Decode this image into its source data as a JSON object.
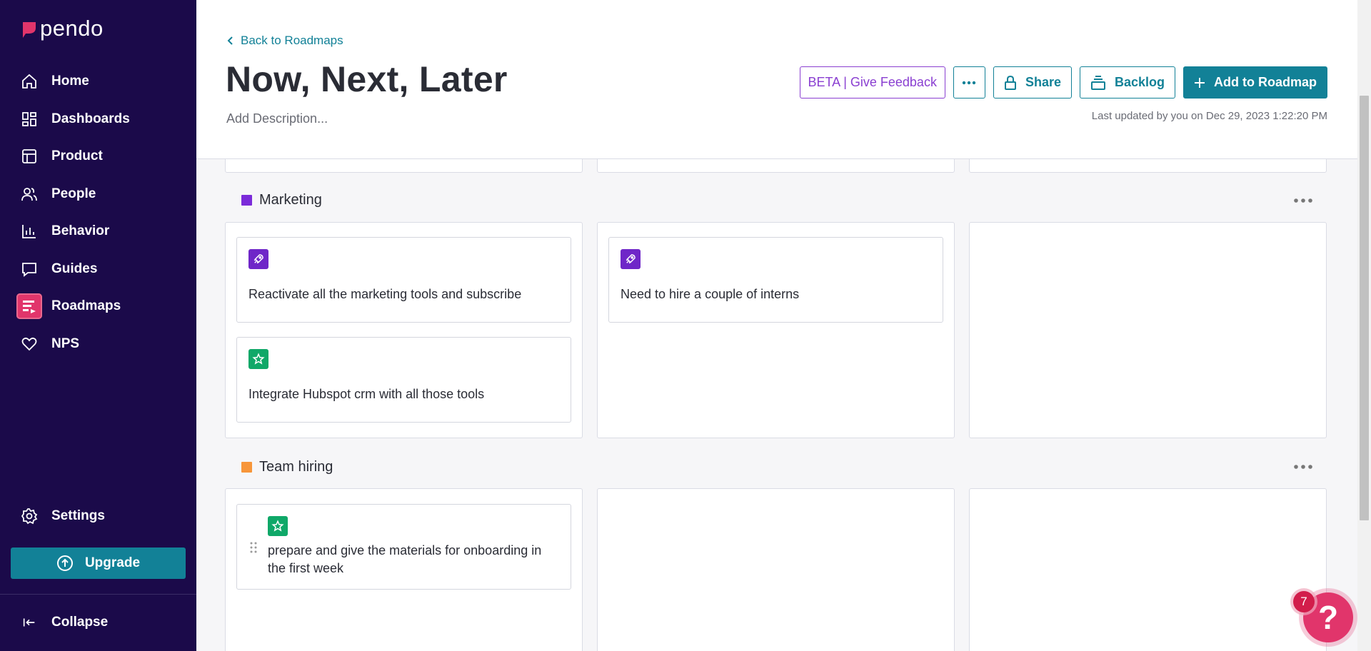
{
  "brand": {
    "name": "pendo",
    "accent": "#e1356b",
    "sidebar_bg": "#1b0a4a",
    "teal": "#128197"
  },
  "sidebar": {
    "items": [
      {
        "label": "Home",
        "icon": "home-icon"
      },
      {
        "label": "Dashboards",
        "icon": "dashboards-icon"
      },
      {
        "label": "Product",
        "icon": "product-icon"
      },
      {
        "label": "People",
        "icon": "people-icon"
      },
      {
        "label": "Behavior",
        "icon": "behavior-icon"
      },
      {
        "label": "Guides",
        "icon": "guides-icon"
      },
      {
        "label": "Roadmaps",
        "icon": "roadmaps-icon",
        "active": true
      },
      {
        "label": "NPS",
        "icon": "heart-icon"
      }
    ],
    "settings_label": "Settings",
    "upgrade_label": "Upgrade",
    "collapse_label": "Collapse"
  },
  "header": {
    "back_label": "Back to Roadmaps",
    "title": "Now, Next, Later",
    "description_placeholder": "Add Description...",
    "beta_label": "BETA | Give Feedback",
    "share_label": "Share",
    "backlog_label": "Backlog",
    "add_label": "Add to Roadmap",
    "updated": "Last updated by you on Dec 29, 2023 1:22:20 PM"
  },
  "lanes": [
    {
      "name": "Marketing",
      "color": "#7b2bd9",
      "columns": [
        [
          {
            "icon": "rocket-icon",
            "text": "Reactivate all the marketing tools and subscribe"
          },
          {
            "icon": "star-icon",
            "text": "Integrate Hubspot crm with all those tools"
          }
        ],
        [
          {
            "icon": "rocket-icon",
            "text": "Need to hire a couple of interns"
          }
        ],
        []
      ]
    },
    {
      "name": "Team hiring",
      "color": "#f7963a",
      "columns": [
        [
          {
            "icon": "star-icon",
            "text": "prepare and give the materials for onboarding in the first week"
          }
        ],
        [],
        []
      ]
    }
  ],
  "help": {
    "badge": "7",
    "glyph": "?"
  }
}
